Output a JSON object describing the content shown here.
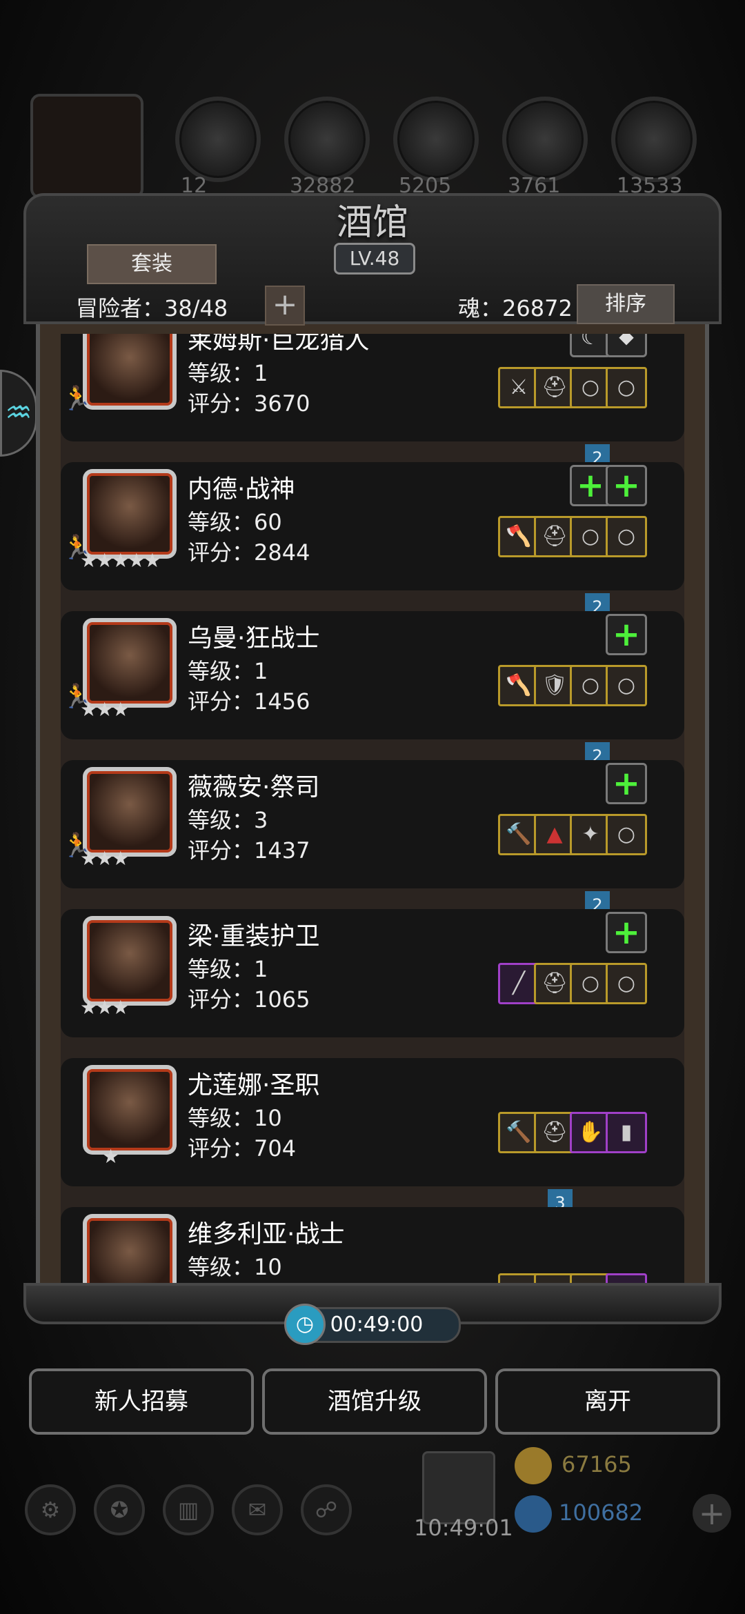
{
  "header": {
    "resources": [
      "",
      "12",
      "32882",
      "5205",
      "3761",
      "13533"
    ]
  },
  "panel": {
    "title": "酒馆",
    "level": "LV.48",
    "set_button": "套装",
    "adventurers_label": "冒险者：38/48",
    "soul_label": "魂：26872",
    "sort_button": "排序"
  },
  "heroes": [
    {
      "name": "莱姆斯·巨龙猎人",
      "level": "等级：1",
      "score": "评分：3670",
      "stars": "",
      "ribbon": "2"
    },
    {
      "name": "内德·战神",
      "level": "等级：60",
      "score": "评分：2844",
      "stars": "★★★★★",
      "ribbon": "2"
    },
    {
      "name": "乌曼·狂战士",
      "level": "等级：1",
      "score": "评分：1456",
      "stars": "★★★",
      "ribbon": "2"
    },
    {
      "name": "薇薇安·祭司",
      "level": "等级：3",
      "score": "评分：1437",
      "stars": "★★★",
      "ribbon": "2"
    },
    {
      "name": "梁·重装护卫",
      "level": "等级：1",
      "score": "评分：1065",
      "stars": "★★★",
      "ribbon": ""
    },
    {
      "name": "尤莲娜·圣职",
      "level": "等级：10",
      "score": "评分：704",
      "stars": "★",
      "ribbon": "3"
    },
    {
      "name": "维多利亚·战士",
      "level": "等级：10",
      "score": "",
      "stars": "",
      "ribbon": ""
    }
  ],
  "timer": "00:49:00",
  "buttons": {
    "recruit": "新人招募",
    "upgrade": "酒馆升级",
    "leave": "离开"
  },
  "hud": {
    "gold": "67165",
    "gems": "100682",
    "clock": "10:49:01"
  },
  "colors": {
    "accent_gold": "#b99a2a",
    "rare_purple": "#a040c8",
    "ribbon_blue": "#2b6f9c",
    "plus_green": "#4df03a"
  }
}
